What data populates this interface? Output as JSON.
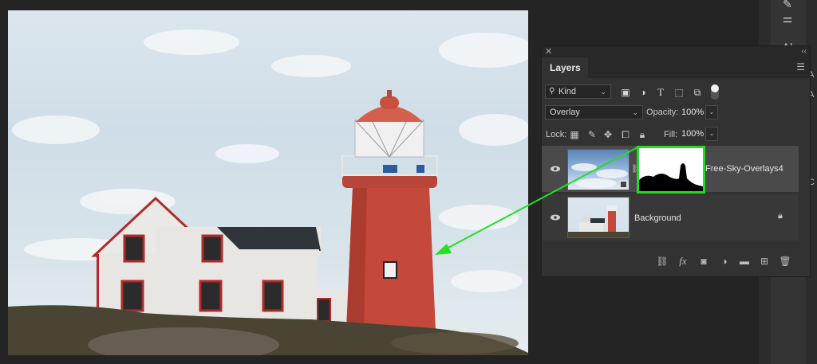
{
  "panel": {
    "title": "Layers",
    "filter_kind": "Kind",
    "blend_mode": "Overlay",
    "opacity_label": "Opacity:",
    "opacity_value": "100%",
    "lock_label": "Lock:",
    "fill_label": "Fill:",
    "fill_value": "100%"
  },
  "layers": [
    {
      "name": "Free-Sky-Overlays4",
      "visible": true,
      "has_mask": true,
      "selected": true
    },
    {
      "name": "Background",
      "visible": true,
      "locked": true,
      "selected": false
    }
  ],
  "dock_letters": [
    "A",
    "A",
    "C"
  ],
  "colors": {
    "mask_highlight": "#2bd62b",
    "arrow": "#22e022",
    "panel_bg": "#323232",
    "selected_row": "#4a4a4a",
    "lighthouse_red": "#c4493a"
  },
  "icons": {
    "filter": [
      "image-filter-icon",
      "adjustment-filter-icon",
      "type-filter-icon",
      "shape-filter-icon",
      "smart-object-filter-icon",
      "filter-toggle-icon"
    ],
    "lock": [
      "lock-transparent-icon",
      "lock-image-icon",
      "lock-position-icon",
      "lock-artboard-icon",
      "lock-all-icon"
    ],
    "footer": [
      "link-layers-icon",
      "fx-icon",
      "add-mask-icon",
      "adjustment-layer-icon",
      "group-icon",
      "new-layer-icon",
      "delete-layer-icon"
    ]
  }
}
